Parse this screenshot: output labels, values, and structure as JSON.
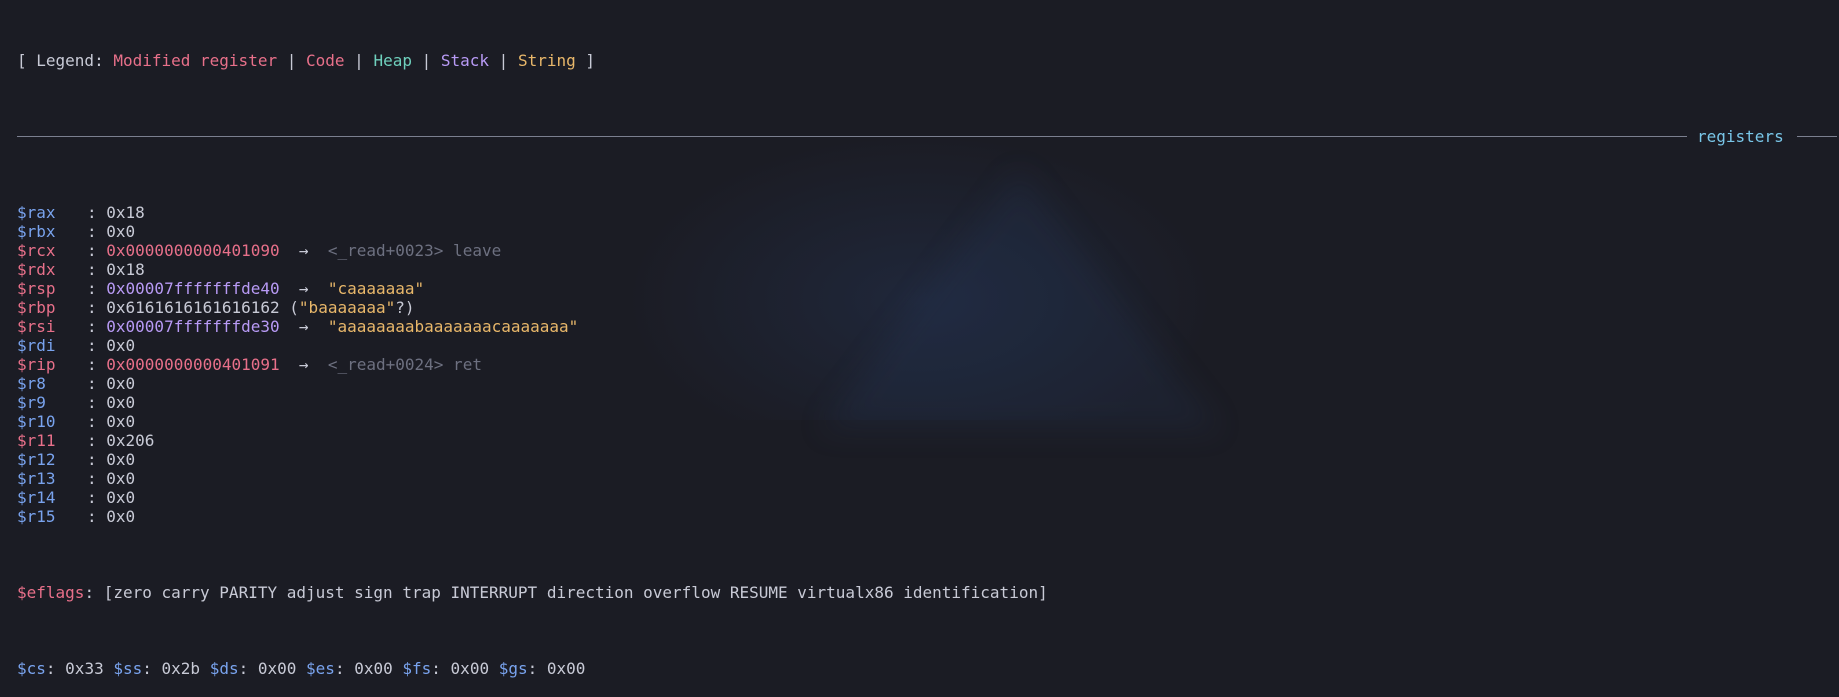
{
  "legend": {
    "open": "[ ",
    "label": "Legend: ",
    "modified": "Modified register",
    "code": "Code",
    "heap": "Heap",
    "stack": "Stack",
    "string": "String",
    "sep": " | ",
    "close": " ]"
  },
  "section_title": "registers",
  "registers": [
    {
      "name": "$rax",
      "modified": false,
      "value": "0x18",
      "kind": "plain"
    },
    {
      "name": "$rbx",
      "modified": false,
      "value": "0x0",
      "kind": "plain"
    },
    {
      "name": "$rcx",
      "modified": true,
      "value": "0x0000000000401090",
      "kind": "code",
      "arrow": "→",
      "target": "<_read+0023> leave",
      "target_kind": "dim"
    },
    {
      "name": "$rdx",
      "modified": true,
      "value": "0x18",
      "kind": "plain"
    },
    {
      "name": "$rsp",
      "modified": true,
      "value": "0x00007fffffffde40",
      "kind": "stack",
      "arrow": "→",
      "target": "\"caaaaaaa\"",
      "target_kind": "string"
    },
    {
      "name": "$rbp",
      "modified": true,
      "value": "0x6161616161616162",
      "kind": "plain",
      "suffix_open": " (",
      "suffix_str": "\"baaaaaaa\"",
      "suffix_close": "?)"
    },
    {
      "name": "$rsi",
      "modified": true,
      "value": "0x00007fffffffde30",
      "kind": "stack",
      "arrow": "→",
      "target": "\"aaaaaaaabaaaaaaacaaaaaaa\"",
      "target_kind": "string"
    },
    {
      "name": "$rdi",
      "modified": false,
      "value": "0x0",
      "kind": "plain"
    },
    {
      "name": "$rip",
      "modified": true,
      "value": "0x0000000000401091",
      "kind": "code",
      "arrow": "→",
      "target": "<_read+0024> ret",
      "target_kind": "dim"
    },
    {
      "name": "$r8",
      "modified": false,
      "value": "0x0",
      "kind": "plain"
    },
    {
      "name": "$r9",
      "modified": false,
      "value": "0x0",
      "kind": "plain"
    },
    {
      "name": "$r10",
      "modified": false,
      "value": "0x0",
      "kind": "plain"
    },
    {
      "name": "$r11",
      "modified": true,
      "value": "0x206",
      "kind": "plain"
    },
    {
      "name": "$r12",
      "modified": false,
      "value": "0x0",
      "kind": "plain"
    },
    {
      "name": "$r13",
      "modified": false,
      "value": "0x0",
      "kind": "plain"
    },
    {
      "name": "$r14",
      "modified": false,
      "value": "0x0",
      "kind": "plain"
    },
    {
      "name": "$r15",
      "modified": false,
      "value": "0x0",
      "kind": "plain"
    }
  ],
  "eflags": {
    "name": "$eflags",
    "value": "[zero carry PARITY adjust sign trap INTERRUPT direction overflow RESUME virtualx86 identification]"
  },
  "segments": [
    {
      "name": "$cs",
      "value": "0x33"
    },
    {
      "name": "$ss",
      "value": "0x2b"
    },
    {
      "name": "$ds",
      "value": "0x00"
    },
    {
      "name": "$es",
      "value": "0x00"
    },
    {
      "name": "$fs",
      "value": "0x00"
    },
    {
      "name": "$gs",
      "value": "0x00"
    }
  ],
  "colors": {
    "background": "#1b1c24",
    "modified": "#e8708a",
    "heap": "#6fd0bd",
    "stack": "#b89af5",
    "string": "#e8b76a",
    "register": "#79a3ee",
    "dim": "#6d7080",
    "title": "#79c6e8"
  }
}
